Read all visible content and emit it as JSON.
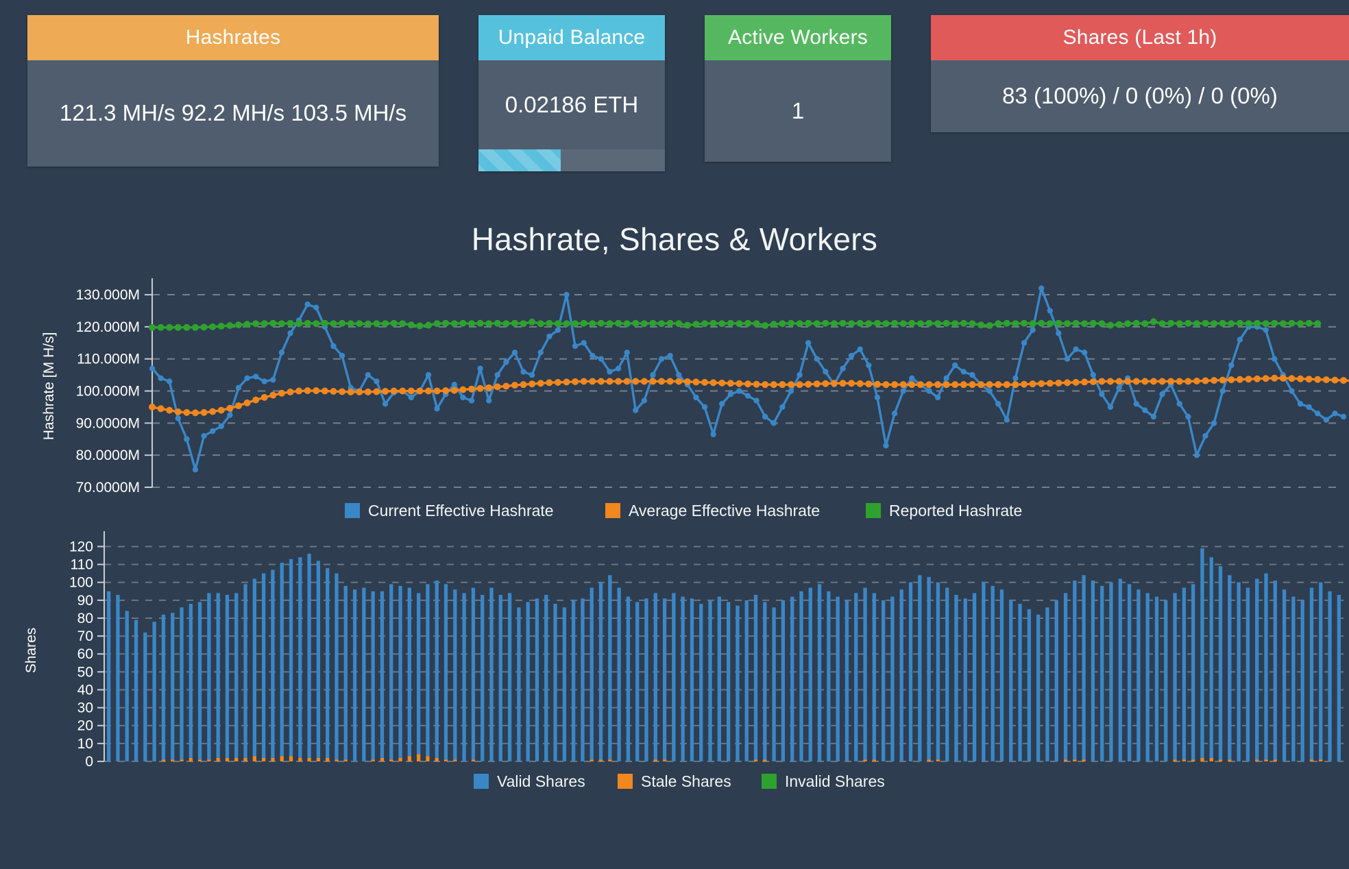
{
  "theme": {
    "background": "#2e3d4f",
    "card_body": "#4f5d6e",
    "blue": "#3a87c8",
    "orange": "#f0871f",
    "green": "#2fa12f",
    "grid": "#9aa6b2"
  },
  "cards": [
    {
      "id": "hashrates",
      "title": "Hashrates",
      "value": "121.3 MH/s  92.2 MH/s  103.5 MH/s",
      "header_color": "#eeaa55",
      "has_progress": false
    },
    {
      "id": "unpaid-balance",
      "title": "Unpaid Balance",
      "value": "0.02186 ETH",
      "header_color": "#55c1dd",
      "has_progress": true,
      "progress_percent": 44,
      "progress_color": "#5bc0de"
    },
    {
      "id": "active-workers",
      "title": "Active Workers",
      "value": "1",
      "header_color": "#55b860",
      "has_progress": false
    },
    {
      "id": "shares-last-1h",
      "title": "Shares (Last 1h)",
      "value": "83 (100%) / 0 (0%) / 0 (0%)",
      "header_color": "#e05a5a",
      "has_progress": false
    }
  ],
  "chart_section": {
    "title": "Hashrate, Shares & Workers"
  },
  "chart_data": [
    {
      "id": "hashrate-chart",
      "type": "line",
      "title": "Hashrate, Shares & Workers",
      "xlabel": "",
      "ylabel": "Hashrate [M H/s]",
      "ylim": [
        70,
        133
      ],
      "yticks": [
        70,
        80,
        90,
        100,
        110,
        120,
        130
      ],
      "ytick_labels": [
        "70.0000M",
        "80.0000M",
        "90.0000M",
        "100.000M",
        "110.000M",
        "120.000M",
        "130.000M"
      ],
      "grid": true,
      "legend_position": "bottom",
      "series": [
        {
          "name": "Current Effective Hashrate",
          "color": "#3a87c8",
          "values": [
            107,
            104,
            103,
            91.5,
            85,
            75.5,
            86,
            87.5,
            89,
            92.5,
            101,
            104,
            104.5,
            103,
            103.5,
            112,
            118,
            122,
            127,
            126,
            120,
            114,
            111,
            101,
            100,
            105,
            103,
            96,
            99.5,
            100,
            98,
            100,
            105,
            94.5,
            99,
            102,
            98,
            97,
            107,
            97,
            105,
            109,
            112,
            106,
            105,
            112,
            117,
            119,
            130,
            114,
            115,
            111,
            110,
            106,
            107,
            112,
            94,
            97,
            105,
            110,
            111,
            105,
            102,
            98,
            95,
            86.5,
            96,
            99,
            100,
            98.5,
            97,
            92,
            90,
            95,
            100,
            105,
            115,
            110,
            106,
            102,
            107,
            111,
            113,
            108,
            98,
            83,
            93,
            100,
            104,
            102,
            100,
            98,
            104,
            108,
            106,
            105,
            102,
            100,
            96,
            91,
            104,
            115,
            119,
            132,
            125,
            118,
            110,
            113,
            112,
            105,
            99,
            95,
            101,
            104,
            96,
            94,
            92,
            99,
            102,
            96,
            92,
            80,
            86,
            90,
            100,
            108,
            116,
            120,
            120,
            119,
            110,
            105,
            100,
            96,
            95,
            93,
            91,
            93,
            92
          ]
        },
        {
          "name": "Average Effective Hashrate",
          "color": "#f0871f",
          "values": [
            95,
            94.5,
            94,
            93.5,
            93.3,
            93.2,
            93.3,
            93.6,
            94,
            94.6,
            95.4,
            96.3,
            97.2,
            98,
            98.7,
            99.3,
            99.7,
            100,
            100.1,
            100.1,
            100,
            99.9,
            99.8,
            99.7,
            99.7,
            99.7,
            99.8,
            99.9,
            100,
            100,
            100,
            100,
            100,
            100,
            100.1,
            100.2,
            100.4,
            100.6,
            100.8,
            101,
            101.3,
            101.5,
            101.8,
            102,
            102.2,
            102.4,
            102.6,
            102.7,
            102.8,
            102.9,
            103,
            103,
            103,
            103,
            103,
            103,
            103,
            103,
            103,
            103,
            103,
            103,
            102.9,
            102.8,
            102.7,
            102.6,
            102.5,
            102.4,
            102.3,
            102.2,
            102.1,
            102,
            102,
            102,
            102,
            102,
            102.1,
            102.2,
            102.3,
            102.4,
            102.4,
            102.4,
            102.3,
            102.2,
            102.1,
            102,
            102,
            102,
            102,
            102,
            102,
            102,
            102,
            102,
            102,
            102,
            102,
            102,
            102,
            102,
            102,
            102.1,
            102.2,
            102.3,
            102.4,
            102.5,
            102.6,
            102.7,
            102.8,
            102.9,
            103,
            103,
            103,
            103,
            103,
            103,
            103,
            103,
            103,
            103,
            103,
            103.1,
            103.2,
            103.3,
            103.4,
            103.5,
            103.6,
            103.7,
            103.8,
            103.9,
            104,
            104,
            103.9,
            103.8,
            103.7,
            103.6,
            103.5,
            103.4,
            103.3,
            103.2
          ]
        },
        {
          "name": "Reported Hashrate",
          "color": "#2fa12f",
          "values": [
            119.8,
            119.8,
            119.8,
            119.8,
            119.8,
            119.8,
            119.9,
            120,
            120.2,
            120.4,
            120.6,
            120.8,
            121,
            121,
            121.1,
            121,
            121.1,
            121,
            121.1,
            121,
            121.1,
            121,
            121.1,
            121,
            121,
            120.9,
            121,
            121,
            121.1,
            121,
            120.6,
            120.3,
            120.5,
            121,
            121.1,
            121,
            121.1,
            121,
            121.1,
            121,
            121.1,
            121,
            121.1,
            121,
            121.5,
            121,
            121.1,
            121,
            121,
            121,
            121.1,
            121,
            121.1,
            121,
            121.1,
            121,
            121.1,
            121,
            121.1,
            121,
            121.1,
            121,
            120.5,
            120.8,
            121,
            121.1,
            121,
            121.1,
            121,
            121.1,
            121,
            120.4,
            120.8,
            121,
            121.1,
            121,
            121.1,
            121,
            121.1,
            121,
            121.1,
            121,
            121.1,
            121,
            121.1,
            121,
            121.1,
            121,
            121.1,
            121,
            121.1,
            121,
            121.1,
            121,
            121.1,
            121,
            120.6,
            120.4,
            121,
            121.1,
            121,
            121.1,
            121,
            121.1,
            121,
            121.1,
            121,
            121.1,
            121,
            121.1,
            121,
            120.5,
            120.7,
            121,
            121.1,
            121,
            121.6,
            121,
            121.1,
            121,
            121.1,
            121,
            121.1,
            121,
            121.1,
            121,
            121.1,
            121,
            121.1,
            121,
            121.1,
            121,
            121.1,
            121,
            121.1,
            121
          ]
        }
      ]
    },
    {
      "id": "shares-chart",
      "type": "bar",
      "title": "",
      "xlabel": "",
      "ylabel": "Shares",
      "ylim": [
        0,
        124
      ],
      "yticks": [
        0,
        10,
        20,
        30,
        40,
        50,
        60,
        70,
        80,
        90,
        100,
        110,
        120
      ],
      "grid": true,
      "legend_position": "bottom",
      "series": [
        {
          "name": "Valid Shares",
          "color": "#3a87c8",
          "values": [
            95,
            93,
            84,
            79,
            72,
            78,
            81,
            82,
            85,
            86,
            88,
            93,
            92,
            91,
            92,
            97,
            99,
            103,
            105,
            108,
            110,
            112,
            114,
            110,
            106,
            104,
            97,
            96,
            97,
            94,
            93,
            98,
            96,
            94,
            90,
            96,
            99,
            98,
            95,
            94,
            96,
            93,
            97,
            93,
            94,
            86,
            89,
            91,
            93,
            88,
            86,
            90,
            91,
            96,
            99,
            103,
            97,
            92,
            89,
            91,
            93,
            90,
            94,
            92,
            91,
            88,
            90,
            92,
            89,
            87,
            90,
            92,
            88,
            86,
            90,
            92,
            95,
            97,
            99,
            95,
            92,
            90,
            94,
            96,
            93,
            90,
            92,
            96,
            100,
            104,
            102,
            99,
            97,
            93,
            91,
            94,
            100,
            98,
            96,
            90,
            88,
            85,
            82,
            86,
            90,
            93,
            100,
            103,
            101,
            98,
            100,
            102,
            99,
            96,
            94,
            92,
            90,
            93,
            96,
            98,
            117,
            112,
            108,
            103,
            100,
            97,
            101,
            104,
            100,
            96,
            92,
            90,
            96,
            99,
            95,
            93
          ]
        },
        {
          "name": "Stale Shares",
          "color": "#f0871f",
          "values": [
            0,
            0,
            0,
            0,
            0,
            0,
            1,
            1,
            1,
            2,
            1,
            1,
            2,
            2,
            2,
            2,
            3,
            2,
            2,
            3,
            3,
            2,
            2,
            2,
            2,
            1,
            1,
            0,
            0,
            1,
            2,
            1,
            2,
            3,
            4,
            3,
            2,
            1,
            1,
            0,
            1,
            0,
            0,
            0,
            0,
            0,
            0,
            0,
            0,
            0,
            0,
            0,
            0,
            1,
            1,
            1,
            0,
            0,
            0,
            0,
            1,
            1,
            0,
            0,
            0,
            0,
            0,
            0,
            0,
            0,
            0,
            1,
            1,
            0,
            0,
            0,
            0,
            0,
            0,
            0,
            0,
            0,
            0,
            1,
            1,
            0,
            0,
            0,
            0,
            0,
            1,
            1,
            0,
            0,
            0,
            0,
            0,
            0,
            0,
            0,
            0,
            0,
            0,
            0,
            0,
            1,
            1,
            1,
            0,
            0,
            0,
            0,
            0,
            0,
            0,
            0,
            0,
            1,
            1,
            1,
            2,
            2,
            1,
            1,
            0,
            0,
            1,
            1,
            1,
            0,
            0,
            0,
            1,
            1,
            0,
            0
          ]
        },
        {
          "name": "Invalid Shares",
          "color": "#2fa12f",
          "values": [
            0,
            0,
            0,
            0,
            0,
            0,
            0,
            0,
            0,
            0,
            0,
            0,
            0,
            0,
            0,
            0,
            0,
            0,
            0,
            0,
            0,
            0,
            0,
            0,
            0,
            0,
            0,
            0,
            0,
            0,
            0,
            0,
            0,
            0,
            0,
            0,
            0,
            0,
            0,
            0,
            0,
            0,
            0,
            0,
            0,
            0,
            0,
            0,
            0,
            0,
            0,
            0,
            0,
            0,
            0,
            0,
            0,
            0,
            0,
            0,
            0,
            0,
            0,
            0,
            0,
            0,
            0,
            0,
            0,
            0,
            0,
            0,
            0,
            0,
            0,
            0,
            0,
            0,
            0,
            0,
            0,
            0,
            0,
            0,
            0,
            0,
            0,
            0,
            0,
            0,
            0,
            0,
            0,
            0,
            0,
            0,
            0,
            0,
            0,
            0,
            0,
            0,
            0,
            0,
            0,
            0,
            0,
            0,
            0,
            0,
            0,
            0,
            0,
            0,
            0,
            0,
            0,
            0,
            0,
            0,
            0,
            0,
            0,
            0,
            0,
            0,
            0,
            0,
            0,
            0,
            0,
            0,
            0,
            0,
            0,
            0
          ]
        }
      ]
    }
  ]
}
